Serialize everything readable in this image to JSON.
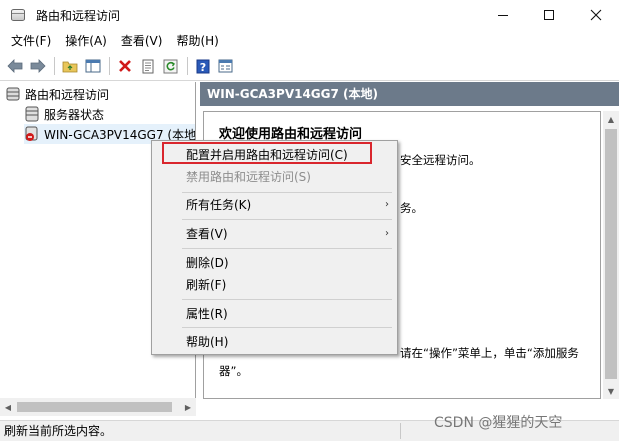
{
  "window": {
    "title": "路由和远程访问"
  },
  "menubar": {
    "items": [
      "文件(F)",
      "操作(A)",
      "查看(V)",
      "帮助(H)"
    ]
  },
  "tree": {
    "root": "路由和远程访问",
    "children": [
      "服务器状态",
      "WIN-GCA3PV14GG7 (本地"
    ]
  },
  "right_pane": {
    "header": "WIN-GCA3PV14GG7 (本地)",
    "welcome_title": "欢迎使用路由和远程访问",
    "fragments": [
      "安全远程访问。",
      "务。",
      "请在“操作”菜单上，单击“添加服务",
      "器”。"
    ]
  },
  "context_menu": {
    "items": [
      "配置并启用路由和远程访问(C)",
      "禁用路由和远程访问(S)",
      "所有任务(K)",
      "查看(V)",
      "删除(D)",
      "刷新(F)",
      "属性(R)",
      "帮助(H)"
    ],
    "arrow": "›"
  },
  "status": {
    "text": "刷新当前所选内容。"
  },
  "watermark": "CSDN @猩猩的天空",
  "colors": {
    "header_bg": "#6c7a8a",
    "highlight": "#d9262d",
    "selected_bg": "#e5f1fb"
  },
  "icons": [
    "app-icon",
    "back-arrow-icon",
    "forward-arrow-icon",
    "up-folder-icon",
    "show-tree-icon",
    "delete-icon",
    "properties-icon",
    "refresh-icon",
    "help-icon",
    "export-list-icon",
    "server-icon",
    "server-status-icon",
    "server-error-icon"
  ]
}
